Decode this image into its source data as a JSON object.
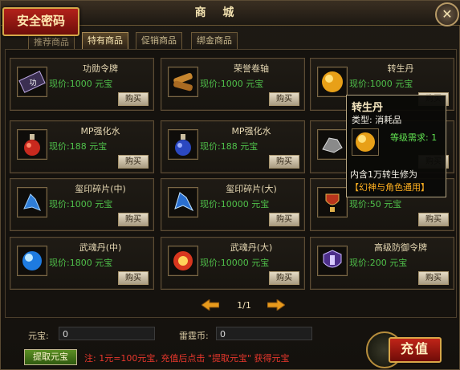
{
  "window": {
    "title": "商 城",
    "secure_label": "安全密码",
    "close_symbol": "✕"
  },
  "tabs": [
    {
      "label": "推荐商品"
    },
    {
      "label": "特有商品"
    },
    {
      "label": "促销商品"
    },
    {
      "label": "绑金商品"
    }
  ],
  "items": [
    {
      "name": "功勋令牌",
      "price_prefix": "现价:",
      "price": "1000",
      "currency": "元宝",
      "buy": "购买",
      "icon": "medal-token-icon",
      "icon_text": "功"
    },
    {
      "name": "荣誉卷轴",
      "price_prefix": "现价:",
      "price": "1000",
      "currency": "元宝",
      "buy": "购买",
      "icon": "scroll-icon"
    },
    {
      "name": "转生丹",
      "price_prefix": "现价:",
      "price": "1000",
      "currency": "元宝",
      "buy": "购买",
      "icon": "golden-pill-icon"
    },
    {
      "name": "MP强化水",
      "price_prefix": "现价:",
      "price": "188",
      "currency": "元宝",
      "buy": "购买",
      "icon": "red-potion-icon"
    },
    {
      "name": "MP强化水",
      "price_prefix": "现价:",
      "price": "188",
      "currency": "元宝",
      "buy": "购买",
      "icon": "blue-potion-icon"
    },
    {
      "name": "",
      "price_prefix": "",
      "price": "",
      "currency": "",
      "buy": "购买",
      "icon": "ore-icon"
    },
    {
      "name": "玺印碎片(中)",
      "price_prefix": "现价:",
      "price": "1000",
      "currency": "元宝",
      "buy": "购买",
      "icon": "crystal-shard-icon"
    },
    {
      "name": "玺印碎片(大)",
      "price_prefix": "现价:",
      "price": "10000",
      "currency": "元宝",
      "buy": "购买",
      "icon": "crystal-shard-icon"
    },
    {
      "name": "",
      "price_prefix": "现价:",
      "price": "50",
      "currency": "元宝",
      "buy": "购买",
      "icon": "trophy-icon"
    },
    {
      "name": "武魂丹(中)",
      "price_prefix": "现价:",
      "price": "1800",
      "currency": "元宝",
      "buy": "购买",
      "icon": "blue-orb-icon"
    },
    {
      "name": "武魂丹(大)",
      "price_prefix": "现价:",
      "price": "10000",
      "currency": "元宝",
      "buy": "购买",
      "icon": "fire-orb-icon"
    },
    {
      "name": "高级防御令牌",
      "price_prefix": "现价:",
      "price": "200",
      "currency": "元宝",
      "buy": "购买",
      "icon": "shield-token-icon"
    }
  ],
  "tooltip": {
    "name": "转生丹",
    "category": "类型: 消耗品",
    "requirement": "等级需求: 1",
    "description": "内含1万转生修为",
    "note_open": "【",
    "note_text": "幻神与角色通用",
    "note_close": "】"
  },
  "pagination": {
    "page": "1/1"
  },
  "footer": {
    "yuanbao_label": "元宝:",
    "yuanbao_value": "0",
    "lei_label": "雷霆币:",
    "lei_value": "0",
    "withdraw_label": "提取元宝",
    "note": "注: 1元=100元宝, 充值后点击 \"提取元宝\" 获得元宝",
    "recharge_label": "充值"
  },
  "colors": {
    "price_green": "#4fc04a",
    "note_red": "#e8372c",
    "accent_gold": "#d4a849"
  }
}
